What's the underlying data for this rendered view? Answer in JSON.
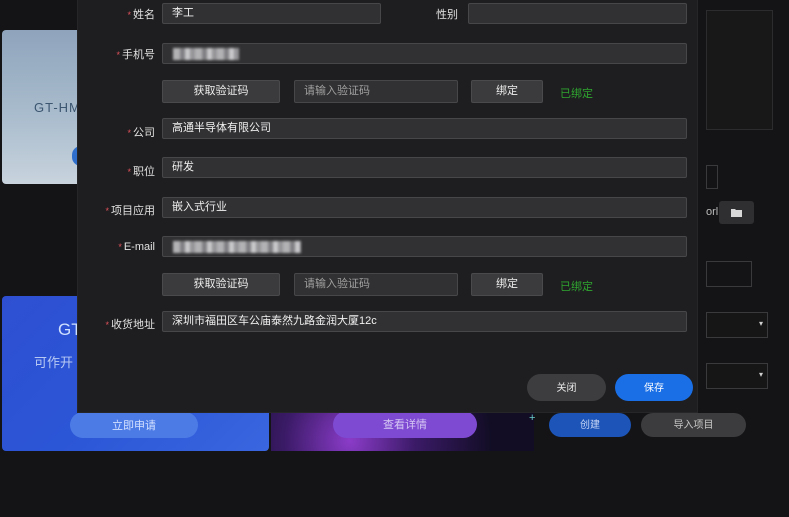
{
  "background": {
    "card1_title": "GT-HM",
    "card2_title": "GT",
    "card2_subtitle": "可作开",
    "apply_button": "立即申请",
    "detail_button": "查看详情",
    "plus": "+",
    "create_button": "创建",
    "import_button": "导入项目",
    "partial_text": "orl",
    "folder_icon": "folder-icon",
    "select_chevron": "▾"
  },
  "form": {
    "name": {
      "label": "姓名",
      "value": "李工"
    },
    "gender": {
      "label": "性别",
      "value": ""
    },
    "phone": {
      "label": "手机号"
    },
    "phone_verify": {
      "get_code": "获取验证码",
      "code_placeholder": "请输入验证码",
      "bind": "绑定",
      "status": "已绑定"
    },
    "company": {
      "label": "公司",
      "value": "高通半导体有限公司"
    },
    "position": {
      "label": "职位",
      "value": "研发"
    },
    "project": {
      "label": "项目应用",
      "value": "嵌入式行业"
    },
    "email": {
      "label": "E-mail"
    },
    "email_verify": {
      "get_code": "获取验证码",
      "code_placeholder": "请输入验证码",
      "bind": "绑定",
      "status": "已绑定"
    },
    "address": {
      "label": "收货地址",
      "value": "深圳市福田区车公庙泰然九路金润大厦12c"
    },
    "required_mark": "*"
  },
  "footer": {
    "close": "关闭",
    "save": "保存"
  },
  "colors": {
    "accent": "#1a6fe6",
    "bound": "#2fa52f",
    "required": "#e0525a"
  }
}
